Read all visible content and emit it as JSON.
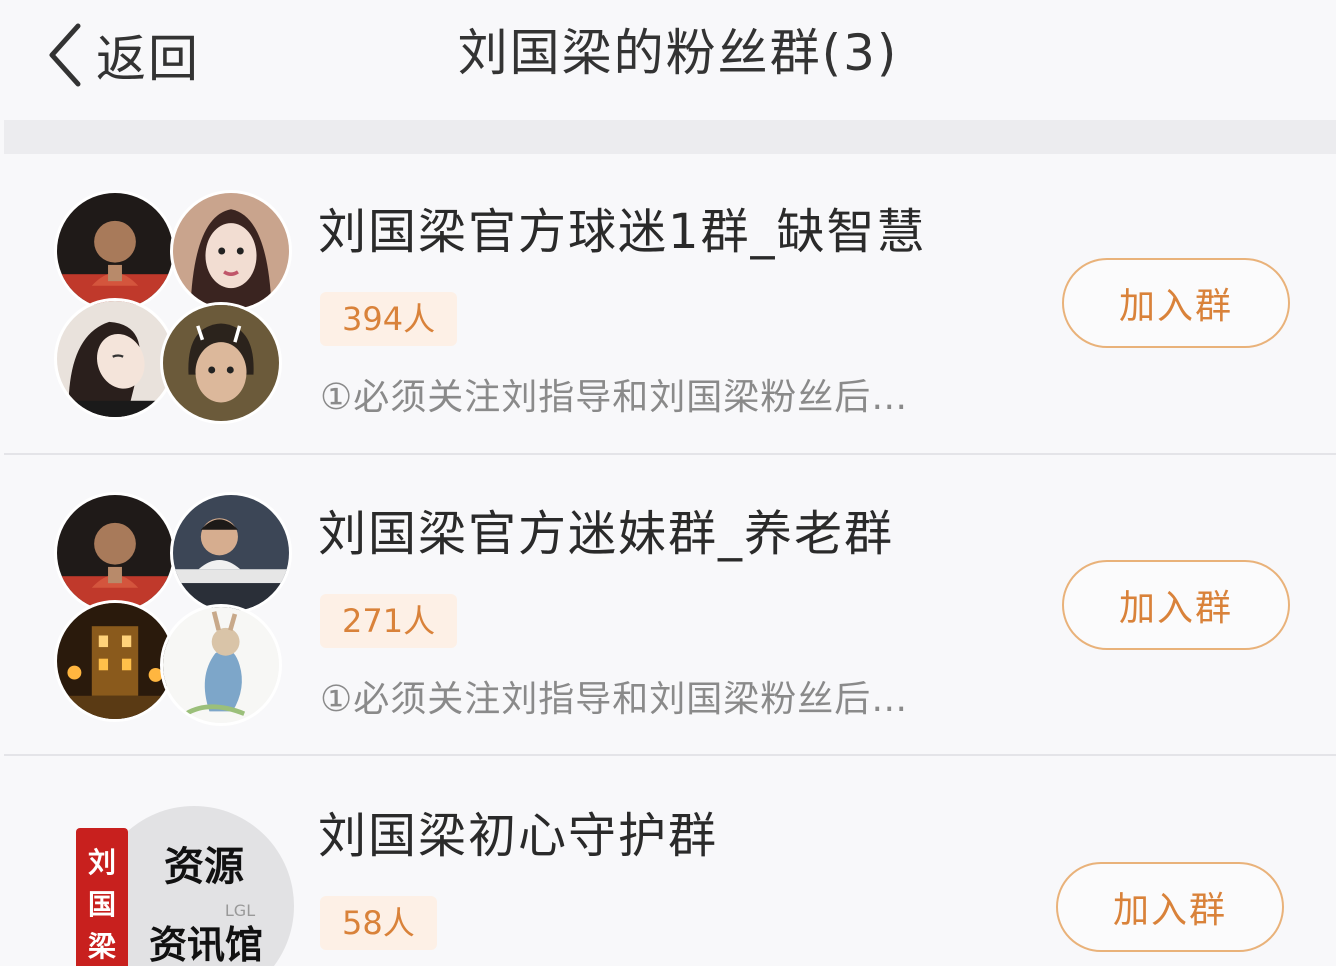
{
  "header": {
    "back_label": "返回",
    "title": "刘国梁的粉丝群(3)"
  },
  "groups": [
    {
      "name": "刘国梁官方球迷1群_缺智慧",
      "members": "394人",
      "description": "①必须关注刘指导和刘国梁粉丝后…",
      "join_label": "加入群"
    },
    {
      "name": "刘国梁官方迷妹群_养老群",
      "members": "271人",
      "description": "①必须关注刘指导和刘国梁粉丝后…",
      "join_label": "加入群"
    },
    {
      "name": "刘国梁初心守护群",
      "members": "58人",
      "join_label": "加入群",
      "avatar_text": [
        "刘国梁",
        "资源",
        "资讯馆",
        "LGL"
      ]
    }
  ],
  "colors": {
    "accent": "#d9823a",
    "badge_bg": "#fdf0e6",
    "button_border": "#e9b27a",
    "background": "#f8f8fa",
    "separator": "#ececef"
  }
}
